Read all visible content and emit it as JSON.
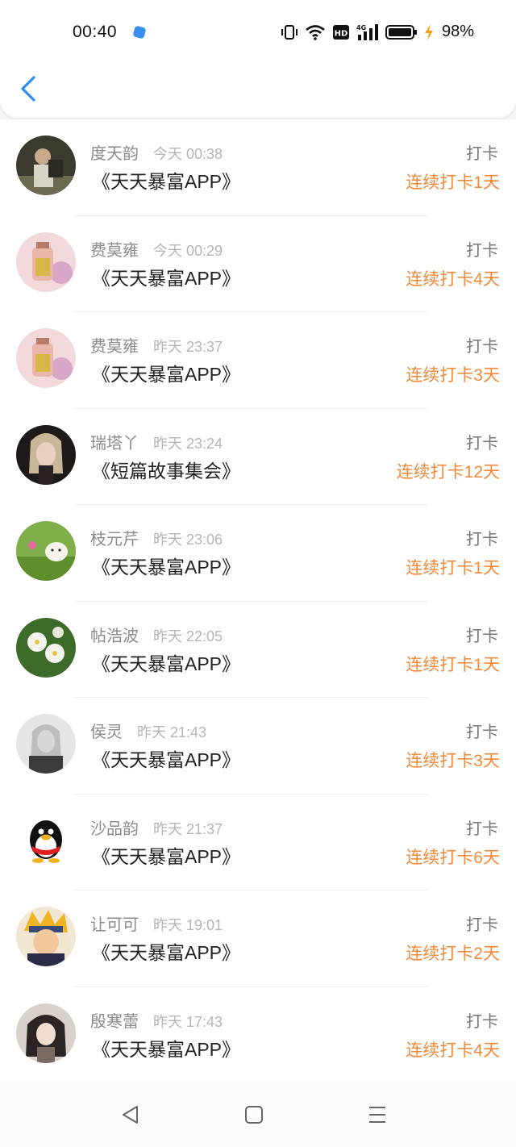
{
  "status_bar": {
    "time": "00:40",
    "battery": "98%",
    "icons": [
      "app-notification-icon",
      "vibrate-icon",
      "wifi-icon",
      "hd-icon",
      "signal-4g-icon",
      "battery-icon",
      "charging-icon"
    ]
  },
  "header": {
    "back_icon": "chevron-left-icon"
  },
  "colors": {
    "accent_orange": "#f08a3a",
    "back_blue": "#2e8ff0"
  },
  "records": [
    {
      "name": "度天韵",
      "time": "今天 00:38",
      "book": "《天天暴富APP》",
      "tag": "打卡",
      "streak": "连续打卡1天"
    },
    {
      "name": "费莫雍",
      "time": "今天 00:29",
      "book": "《天天暴富APP》",
      "tag": "打卡",
      "streak": "连续打卡4天"
    },
    {
      "name": "费莫雍",
      "time": "昨天 23:37",
      "book": "《天天暴富APP》",
      "tag": "打卡",
      "streak": "连续打卡3天"
    },
    {
      "name": "瑞塔丫",
      "time": "昨天 23:24",
      "book": "《短篇故事集会》",
      "tag": "打卡",
      "streak": "连续打卡12天"
    },
    {
      "name": "枝元芹",
      "time": "昨天 23:06",
      "book": "《天天暴富APP》",
      "tag": "打卡",
      "streak": "连续打卡1天"
    },
    {
      "name": "帖浩波",
      "time": "昨天 22:05",
      "book": "《天天暴富APP》",
      "tag": "打卡",
      "streak": "连续打卡1天"
    },
    {
      "name": "侯灵",
      "time": "昨天 21:43",
      "book": "《天天暴富APP》",
      "tag": "打卡",
      "streak": "连续打卡3天"
    },
    {
      "name": "沙品韵",
      "time": "昨天 21:37",
      "book": "《天天暴富APP》",
      "tag": "打卡",
      "streak": "连续打卡6天"
    },
    {
      "name": "让可可",
      "time": "昨天 19:01",
      "book": "《天天暴富APP》",
      "tag": "打卡",
      "streak": "连续打卡2天"
    },
    {
      "name": "殷寒蕾",
      "time": "昨天 17:43",
      "book": "《天天暴富APP》",
      "tag": "打卡",
      "streak": "连续打卡4天"
    }
  ],
  "nav_bar": {
    "icons": [
      "back-triangle-icon",
      "home-square-icon",
      "menu-lines-icon"
    ]
  }
}
